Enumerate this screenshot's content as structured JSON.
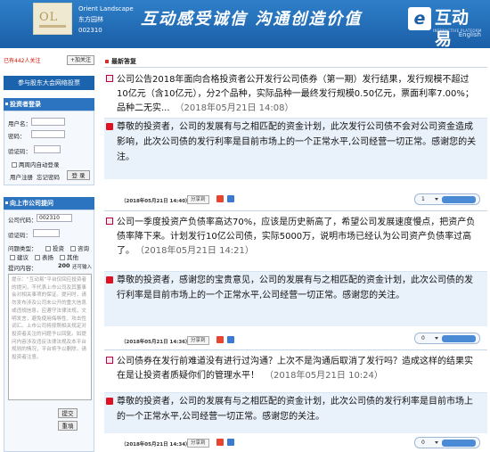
{
  "header": {
    "company_en": "Orient Landscape",
    "company_cn": "东方园林",
    "stock_code": "002310",
    "slogan": "互动感受诚信  沟通创造价值",
    "brand_badge": "e",
    "brand_name": "互动易",
    "brand_tag": "INTERACTIVE PLATFORM",
    "lang_link": "English"
  },
  "sidebar": {
    "follow_count": "已有442人关注",
    "follow_button": "+加关注",
    "roadshow_button": "参与股东大会网络投票",
    "login": {
      "title": "投资者登录",
      "user_label": "用户名：",
      "password_label": "密码：",
      "captcha_label": "验证码：",
      "remember_label": "两周内自动登录",
      "register_link": "用户注册",
      "forgot_link": "忘记密码",
      "login_button": "登 录"
    },
    "ask": {
      "title": "向上市公司提问",
      "code_label": "公司代码：",
      "code_value": "002310",
      "captcha_label": "验证码：",
      "type_label": "问题类型：",
      "types": [
        "投资",
        "咨询",
        "建议",
        "表扬",
        "其他"
      ],
      "content_label": "提问内容：",
      "char_limit": "200",
      "char_suffix": "还可输入",
      "notice": "提示：“互动易”平台仅回应投资者的提问，不代表上市公司及其董事会对相关事项的保证。提问时，请勿发布涉及公司未公开的重大信息或违规信息，应遵守法律法规，文明发言，避免使用侮辱性、攻击性词汇。上市公司将按照相关规定对投资者关注的问题予以回复。如提问内容涉及违反法律法规及本平台规则的情况，平台将予以删除，请投资者注意。",
      "submit_button": "提交",
      "reset_button": "重填"
    }
  },
  "main": {
    "section_title": "最新答复",
    "items": [
      {
        "question": "公司公告2018年面向合格投资者公开发行公司债券（第一期）发行结果，发行规模不超过10亿元（含10亿元），分2个品种，实际品种一最终发行规模0.50亿元，票面利率7.00%；品种二无实...",
        "question_time": "（2018年05月21日 14:08）",
        "answer": "尊敬的投资者，公司的发展有与之相匹配的资金计划，此次发行公司债不会对公司资金造成影响，此次公司债的发行利率是目前市场上的一个正常水平,公司经营一切正常。感谢您的关注。",
        "answer_time": "（2018年05月21日 14:40）",
        "share": "分享到",
        "votes": "1"
      },
      {
        "question": "公司一季度投资产负债率高达70%，应该是历史新高了，希望公司发展速度慢点，把资产负债率降下来。计划发行10亿公司债，实际5000万，说明市场已经认为公司资产负债率过高了。",
        "question_time": "（2018年05月21日 14:21）",
        "answer": "尊敬的投资者，感谢您的宝贵意见，公司的发展有与之相匹配的资金计划，此次公司债的发行利率是目前市场上的一个正常水平,公司经营一切正常。感谢您的关注。",
        "answer_time": "（2018年05月21日 14:36）",
        "share": "分享到",
        "votes": "0"
      },
      {
        "question": "公司债券在发行前难道没有进行过沟通？上次不是沟通后取消了发行吗？造成这样的结果实在是让投资者质疑你们的管理水平！",
        "question_time": "（2018年05月21日 10:24）",
        "answer": "尊敬的投资者，公司的发展有与之相匹配的资金计划，此次公司债的发行利率是目前市场上的一个正常水平,公司经营一切正常。感谢您的关注。",
        "answer_time": "（2018年05月21日 14:34）",
        "share": "分享到",
        "votes": "0"
      }
    ]
  },
  "colors": {
    "header_blue": "#1a5fa8",
    "panel_blue": "#2c74c0",
    "answer_bg": "#e9f1fb",
    "accent_red": "#d12"
  }
}
